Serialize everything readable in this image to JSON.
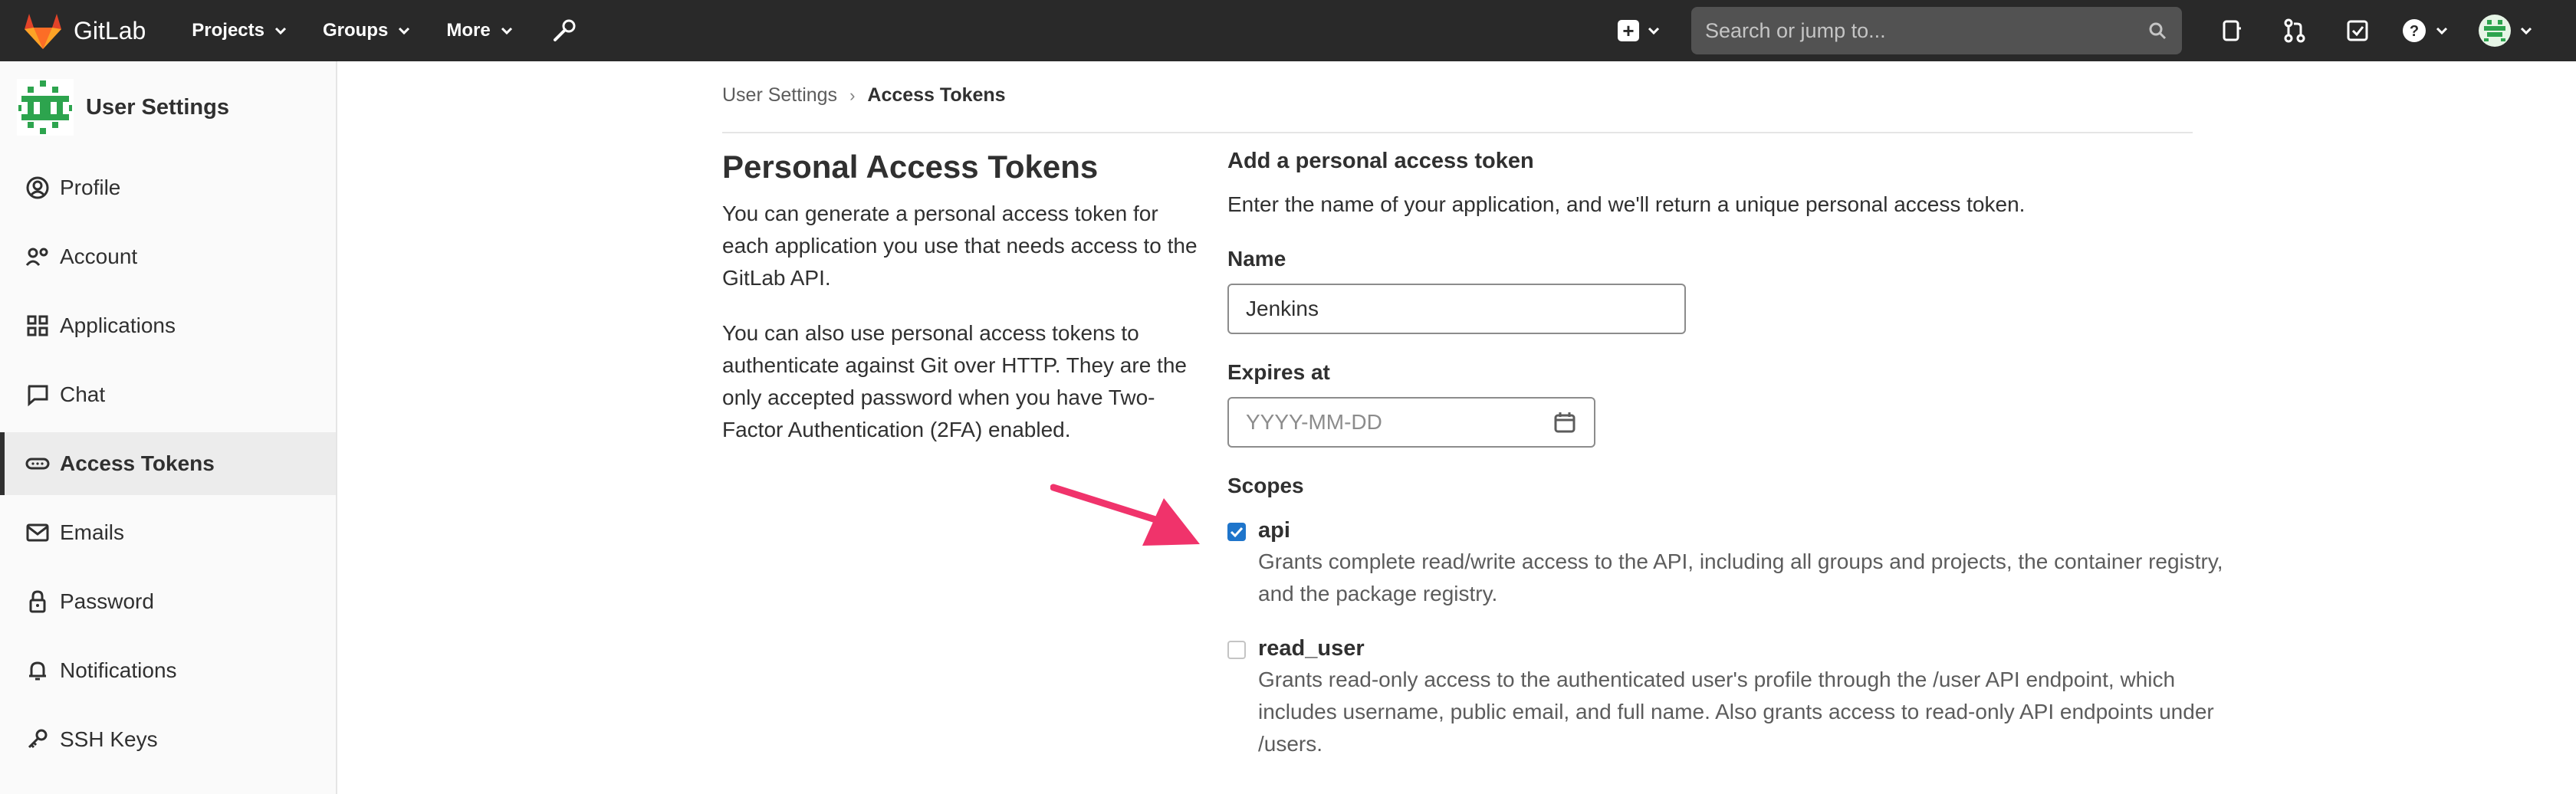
{
  "navbar": {
    "brand": "GitLab",
    "items": [
      "Projects",
      "Groups",
      "More"
    ],
    "search_placeholder": "Search or jump to..."
  },
  "sidebar": {
    "title": "User Settings",
    "items": [
      {
        "label": "Profile",
        "icon": "profile-icon"
      },
      {
        "label": "Account",
        "icon": "account-icon"
      },
      {
        "label": "Applications",
        "icon": "applications-icon"
      },
      {
        "label": "Chat",
        "icon": "chat-icon"
      },
      {
        "label": "Access Tokens",
        "icon": "token-icon",
        "active": true
      },
      {
        "label": "Emails",
        "icon": "mail-icon"
      },
      {
        "label": "Password",
        "icon": "lock-icon"
      },
      {
        "label": "Notifications",
        "icon": "bell-icon"
      },
      {
        "label": "SSH Keys",
        "icon": "key-icon"
      }
    ]
  },
  "breadcrumb": {
    "parent": "User Settings",
    "current": "Access Tokens"
  },
  "intro": {
    "title": "Personal Access Tokens",
    "p1": "You can generate a personal access token for each application you use that needs access to the GitLab API.",
    "p2": "You can also use personal access tokens to authenticate against Git over HTTP. They are the only accepted password when you have Two-Factor Authentication (2FA) enabled."
  },
  "form": {
    "title": "Add a personal access token",
    "description": "Enter the name of your application, and we'll return a unique personal access token.",
    "name_label": "Name",
    "name_value": "Jenkins",
    "expires_label": "Expires at",
    "expires_placeholder": "YYYY-MM-DD",
    "scopes_label": "Scopes",
    "scopes": [
      {
        "name": "api",
        "checked": true,
        "description": "Grants complete read/write access to the API, including all groups and projects, the container registry, and the package registry."
      },
      {
        "name": "read_user",
        "checked": false,
        "description": "Grants read-only access to the authenticated user's profile through the /user API endpoint, which includes username, public email, and full name. Also grants access to read-only API endpoints under /users."
      }
    ]
  },
  "colors": {
    "navbar": "#292929",
    "accent_arrow": "#f0336b",
    "checkbox": "#1f75cb"
  }
}
